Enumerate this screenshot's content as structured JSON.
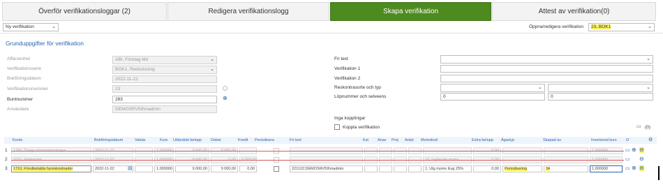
{
  "tabs": [
    {
      "label": "Överför verifikationsloggar (2)"
    },
    {
      "label": "Redigera verifikationslogg"
    },
    {
      "label": "Skapa verifikation"
    },
    {
      "label": "Attest av verifikation(0)"
    }
  ],
  "toolbar": {
    "type_select": "Ny verifikation",
    "open_label": "Öppna/redigera verifikation",
    "open_value": "23, BOK1"
  },
  "section_title": "Grunduppgifter för verifikation",
  "form_left": {
    "affarsenhet_label": "Affärsenhet",
    "affarsenhet_value": "ABI, Företag Mö",
    "verserie_label": "Verifikationsserie",
    "verserie_value": "BOK1, Redovisning",
    "bokdatum_label": "Bokföringsdatum",
    "bokdatum_value": "2022-11-22",
    "vernummer_label": "Verifikationsnummer",
    "vernummer_value": "23",
    "buntnummer_label": "Buntnummer",
    "buntnummer_value": "283",
    "anvandare_label": "Användare",
    "anvandare_value": "DEMOSRV59\\madmin"
  },
  "form_right": {
    "fritext_label": "Fri text",
    "ver1_label": "Verifikation 1",
    "ver2_label": "Verifikation 2",
    "reskontra_label": "Reskontrasorte och typ",
    "lopnummer_label": "Löpnummer och selveens",
    "lop_a": "0",
    "lop_b": "0",
    "kopplingar_label": "Inga kopplingar",
    "koppla_label": "Koppla verifikation",
    "attach_count": "(0)"
  },
  "grid": {
    "headers": [
      "Konto",
      "Bokföringsdatum",
      "Valuta",
      "Kurs",
      "Utländskt belopp",
      "Debet",
      "Kredit",
      "Periodisera",
      "Fri text",
      "Kst",
      "Anav",
      "Proj",
      "Antal",
      "Momskod",
      "Extra belopp",
      "Ägartyp",
      "Skapad av",
      "Inverterad kurs",
      "O"
    ],
    "rows": [
      {
        "nr": "1",
        "konto": "1790, Övriga interimsfordringar",
        "date": "2022-11-22",
        "kurs": "1,000000",
        "utl": "9 000,00",
        "debet": "9 000,00",
        "kredit": "",
        "fritext": "",
        "momskod": "",
        "extra": "0,00",
        "agartyp": "",
        "skapad": "",
        "inv": "1,000000"
      },
      {
        "nr": "2",
        "konto": "1010, Elektricitet",
        "date": "2022-11-22",
        "kurs": "1,000000",
        "utl": "-9 000,00",
        "debet": "0,00",
        "kredit": "9 000,00",
        "fritext": "",
        "momskod": "10, Ingående moms",
        "extra": "0,00",
        "agartyp": "",
        "skapad": "",
        "inv": "1,000000"
      },
      {
        "nr": "3",
        "konto": "1710, Förutbetalda hyreskostnader",
        "date": "2022-11-22",
        "kurs": "1,000000",
        "utl": "9 000,00",
        "debet": "9 000,00",
        "kredit": "0,00",
        "fritext": "221122;DEMOSRV59\\madmin",
        "momskod": "1, Utg moms Eug 25%",
        "extra": "0,00",
        "agartyp": "Periodisering",
        "skapad": "34",
        "inv": "1,000000"
      }
    ]
  },
  "colors": {
    "accent": "#4d8a1f",
    "link": "#2a64b0",
    "highlight": "#fff35c"
  }
}
